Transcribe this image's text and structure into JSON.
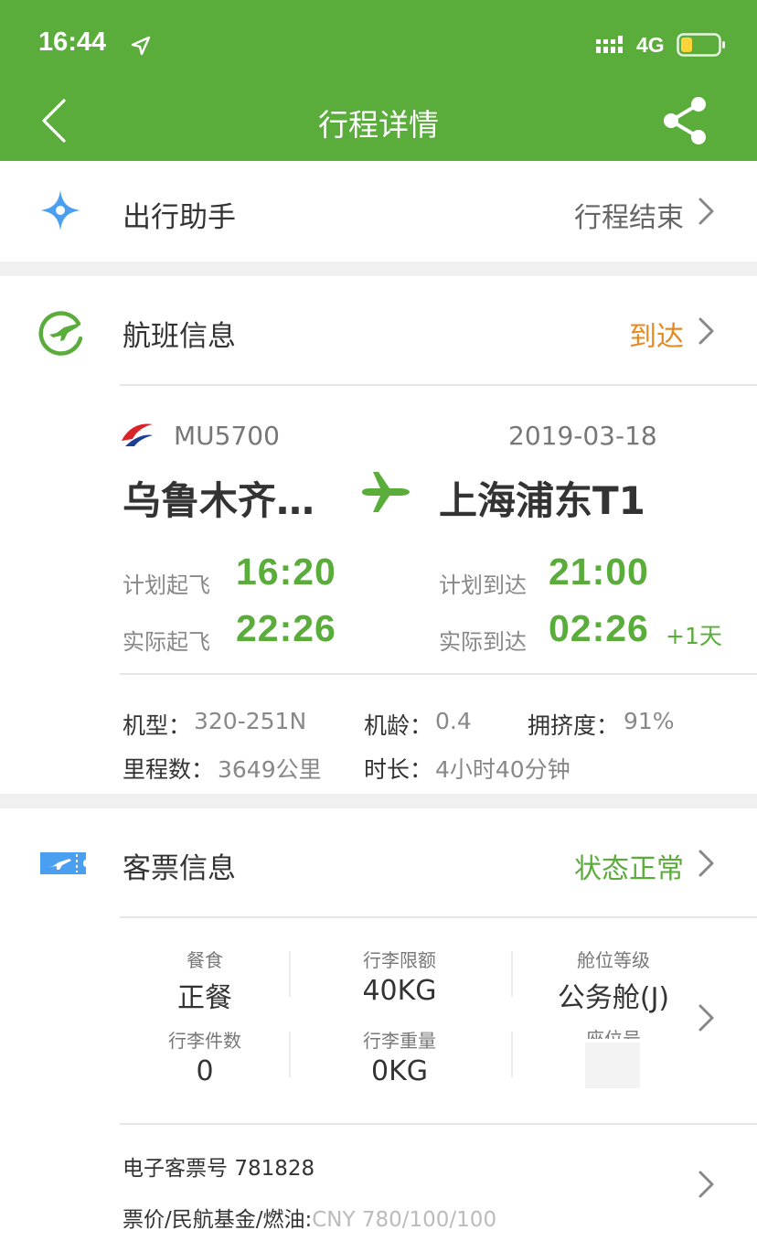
{
  "status_bar": {
    "time": "16:44",
    "network": "4G"
  },
  "header": {
    "title": "行程详情"
  },
  "assistant": {
    "title": "出行助手",
    "status": "行程结束"
  },
  "flight_section": {
    "title": "航班信息",
    "status": "到达",
    "flight_no": "MU5700",
    "date": "2019-03-18",
    "origin": "乌鲁木齐…",
    "destination": "上海浦东T1",
    "plan_dep_label": "计划起飞",
    "plan_dep_time": "16:20",
    "plan_arr_label": "计划到达",
    "plan_arr_time": "21:00",
    "act_dep_label": "实际起飞",
    "act_dep_time": "22:26",
    "act_arr_label": "实际到达",
    "act_arr_time": "02:26",
    "plus_day": "+1天",
    "aircraft_label": "机型：",
    "aircraft": "320-251N",
    "age_label": "机龄：",
    "age": "0.4",
    "crowd_label": "拥挤度：",
    "crowd": "91%",
    "distance_label": "里程数：",
    "distance": "3649公里",
    "duration_label": "时长：",
    "duration": "4小时40分钟"
  },
  "ticket_section": {
    "title": "客票信息",
    "status": "状态正常",
    "meal_label": "餐食",
    "meal": "正餐",
    "baggage_limit_label": "行李限额",
    "baggage_limit": "40KG",
    "cabin_label": "舱位等级",
    "cabin": "公务舱(J)",
    "baggage_count_label": "行李件数",
    "baggage_count": "0",
    "baggage_weight_label": "行李重量",
    "baggage_weight": "0KG",
    "seat_label": "座位号",
    "eticket_label": "电子客票号",
    "eticket": "781828",
    "fare_label": "票价/民航基金/燃油:",
    "fare": "CNY 780/100/100"
  },
  "colors": {
    "brand_green": "#5aad3b",
    "status_orange": "#e8891e",
    "icon_blue": "#4a9ff0"
  }
}
